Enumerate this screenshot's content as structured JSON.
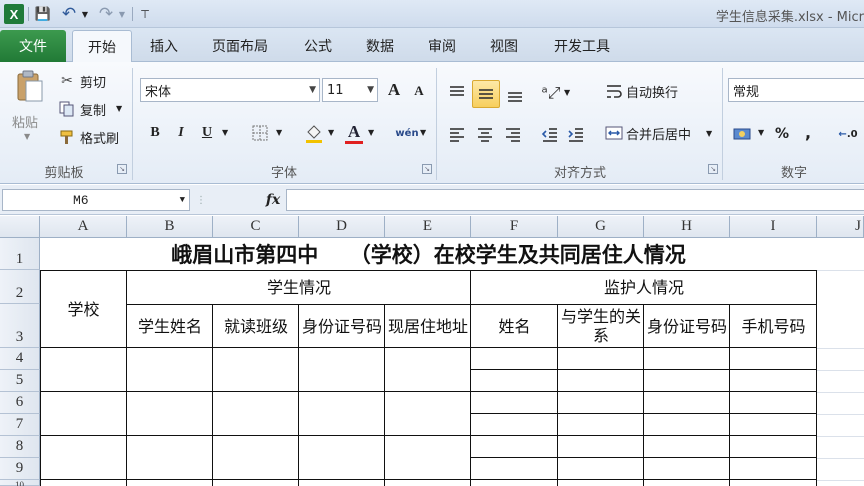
{
  "app": {
    "logo": "X",
    "save_icon": "💾",
    "undo_icon": "↶",
    "redo_icon": "↷",
    "qa_customize": "⊤",
    "title": "学生信息采集.xlsx - Micr"
  },
  "tabs": [
    {
      "label": "文件"
    },
    {
      "label": "开始"
    },
    {
      "label": "插入"
    },
    {
      "label": "页面布局"
    },
    {
      "label": "公式"
    },
    {
      "label": "数据"
    },
    {
      "label": "审阅"
    },
    {
      "label": "视图"
    },
    {
      "label": "开发工具"
    }
  ],
  "ribbon": {
    "clipboard": {
      "paste": "粘贴",
      "cut": "剪切",
      "copy": "复制",
      "format_painter": "格式刷",
      "label": "剪贴板"
    },
    "font": {
      "name": "宋体",
      "size": "11",
      "grow": "A",
      "shrink": "A",
      "bold": "B",
      "italic": "I",
      "underline": "U",
      "phonetic": "wén",
      "label": "字体"
    },
    "alignment": {
      "wrap_text": "自动换行",
      "merge_center": "合并后居中",
      "label": "对齐方式"
    },
    "number": {
      "format": "常规",
      "percent": "%",
      "comma": ",",
      "increase_decimal": ".0",
      "label": "数字"
    }
  },
  "formula_bar": {
    "name_box": "M6",
    "fx": "fx",
    "formula": ""
  },
  "columns": [
    "A",
    "B",
    "C",
    "D",
    "E",
    "F",
    "G",
    "H",
    "I",
    "J"
  ],
  "rows": [
    "1",
    "2",
    "3",
    "4",
    "5",
    "6",
    "7",
    "8",
    "9",
    "10"
  ],
  "sheet": {
    "title": "峨眉山市第四中　　（学校）在校学生及共同居住人情况",
    "school": "学校",
    "student_group": "学生情况",
    "guardian_group": "监护人情况",
    "student_name": "学生姓名",
    "class": "就读班级",
    "id_number": "身份证号码",
    "address": "现居住地址",
    "guardian_name": "姓名",
    "relation": "与学生的关系",
    "guardian_id": "身份证号码",
    "phone": "手机号码"
  }
}
